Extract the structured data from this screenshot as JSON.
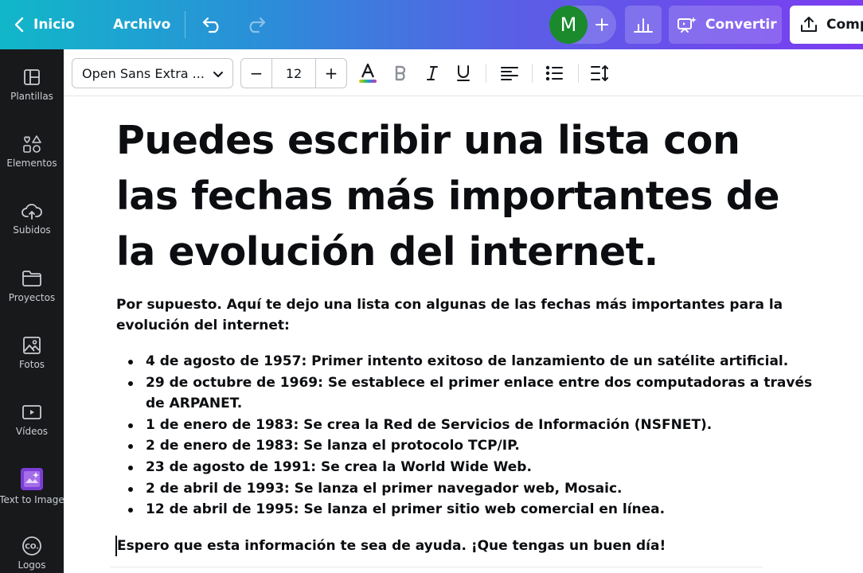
{
  "topbar": {
    "back_label": "Inicio",
    "file_label": "Archivo",
    "avatar_initial": "M",
    "convert_label": "Convertir",
    "share_label": "Comp"
  },
  "sidebar": {
    "items": [
      {
        "label": "Plantillas",
        "icon": "templates-icon"
      },
      {
        "label": "Elementos",
        "icon": "elements-icon"
      },
      {
        "label": "Subidos",
        "icon": "upload-cloud-icon"
      },
      {
        "label": "Proyectos",
        "icon": "folder-icon"
      },
      {
        "label": "Fotos",
        "icon": "image-icon"
      },
      {
        "label": "Vídeos",
        "icon": "video-icon"
      },
      {
        "label": "Text to Image",
        "icon": "text-to-image-icon"
      },
      {
        "label": "Logos",
        "icon": "logo-co-icon"
      }
    ]
  },
  "toolbar": {
    "font_family": "Open Sans Extra ...",
    "font_size": "12",
    "decrease": "−",
    "increase": "+"
  },
  "document": {
    "heading": "Puedes escribir una lista con las fechas más importantes de la evolución del internet.",
    "intro": "Por supuesto. Aquí te dejo una lista con algunas de las fechas más importantes para la evolución del internet:",
    "items": [
      "4 de agosto de 1957: Primer intento exitoso de lanzamiento de un satélite artificial.",
      "29 de octubre de 1969: Se establece el primer enlace entre dos computadoras a través de ARPANET.",
      "1 de enero de 1983: Se crea la Red de Servicios de Información (NSFNET).",
      "2 de enero de 1983: Se lanza el protocolo TCP/IP.",
      "23 de agosto de 1991: Se crea la World Wide Web.",
      "2 de abril de 1993: Se lanza el primer navegador web, Mosaic.",
      "12 de abril de 1995: Se lanza el primer sitio web comercial en línea."
    ],
    "outro": "Espero que esta información te sea de ayuda. ¡Que tengas un buen día!"
  },
  "colors": {
    "sidebar_bg": "#18191b",
    "avatar_bg": "#1a8a2c",
    "gradient_start": "#11b7c9",
    "gradient_end": "#7b3df0"
  }
}
